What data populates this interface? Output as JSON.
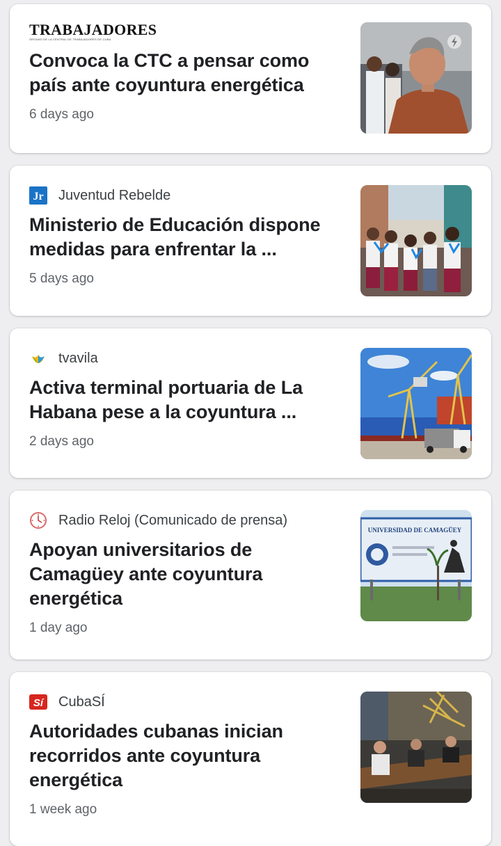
{
  "articles": [
    {
      "source": "TRABAJADORES",
      "source_subtitle": "ÓRGANO DE LA CENTRAL DE TRABAJADORES DE CUBA",
      "headline": "Convoca la CTC a pensar como país ante coyuntura energética",
      "age": "6 days ago",
      "icon": "trabajadores-logo",
      "thumb_badge": "amp-lightning-icon"
    },
    {
      "source": "Juventud Rebelde",
      "headline": "Ministerio de Educación dispone medidas para enfrentar la ...",
      "age": "5 days ago",
      "icon": "jr-logo-icon",
      "icon_text": "JR"
    },
    {
      "source": "tvavila",
      "headline": "Activa terminal portuaria de La Habana pese a la coyuntura ...",
      "age": "2 days ago",
      "icon": "tvavila-logo-icon"
    },
    {
      "source": "Radio Reloj (Comunicado de prensa)",
      "headline": "Apoyan universitarios de Camagüey ante coyuntura energética",
      "age": "1 day ago",
      "icon": "clock-icon",
      "thumb_sign_text": "UNIVERSIDAD DE CAMAGÜEY"
    },
    {
      "source": "CubaSÍ",
      "headline": "Autoridades cubanas inician recorridos ante coyuntura energética",
      "age": "1 week ago",
      "icon": "cubasi-logo-icon",
      "icon_text": "Sí"
    }
  ],
  "colors": {
    "background": "#eeeef0",
    "card": "#ffffff",
    "headline": "#202124",
    "meta": "#5f6368",
    "jr_blue": "#1a73c7",
    "cubasi_red": "#d7261e"
  }
}
